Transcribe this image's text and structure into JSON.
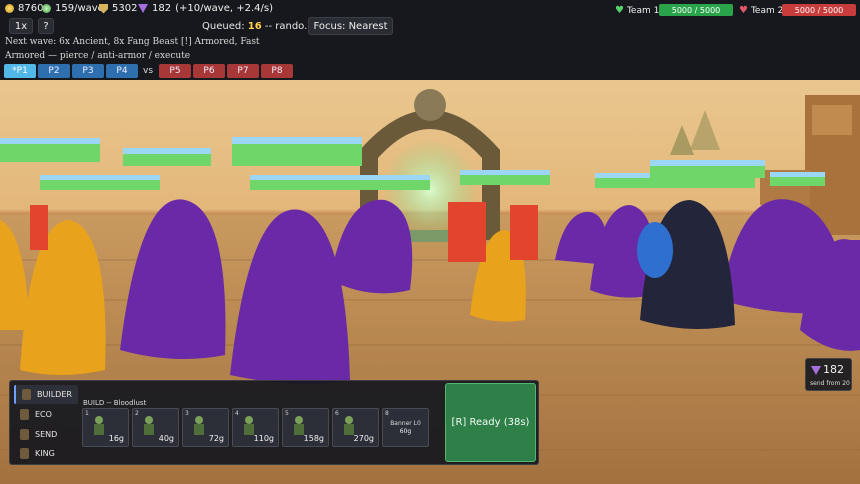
{
  "hud": {
    "gold": "8760",
    "income": "159/wave",
    "shields": "5302",
    "gems": "182",
    "gem_rate": "(+10/wave, +2.4/s)",
    "speed_button": "1x",
    "help_button": "?",
    "queued_label": "Queued: ",
    "queued_count": "16",
    "queued_rest": " -- rando...",
    "focus_button": "Focus: Nearest",
    "next_wave": "Next wave: 6x Ancient, 8x Fang Beast  [!] Armored, Fast",
    "armor_line": "Armored — pierce / anti-armor / execute",
    "players": [
      "*P1",
      "P2",
      "P3",
      "P4",
      "P5",
      "P6",
      "P7",
      "P8"
    ],
    "vs": "vs",
    "team1_label": "Team 1",
    "team1_hp": "5000 / 5000",
    "team2_label": "Team 2",
    "team2_hp": "5000 / 5000",
    "colors": {
      "team1": "#2aa44a",
      "team2": "#c93c3c",
      "accent": "#52b8e8"
    }
  },
  "panel": {
    "tabs": [
      "BUILDER",
      "ECO",
      "SEND",
      "KING"
    ],
    "build_title": "BUILD -- Bloodlust",
    "cards": [
      {
        "num": "1",
        "cost": "16g"
      },
      {
        "num": "2",
        "cost": "40g"
      },
      {
        "num": "3",
        "cost": "72g"
      },
      {
        "num": "4",
        "cost": "110g"
      },
      {
        "num": "5",
        "cost": "158g"
      },
      {
        "num": "6",
        "cost": "270g"
      }
    ],
    "banner": {
      "num": "8",
      "name": "Banner L0",
      "cost": "60g"
    },
    "ready_button": "[R] Ready (38s)"
  },
  "send": {
    "count": "182",
    "from": "send from 20"
  }
}
